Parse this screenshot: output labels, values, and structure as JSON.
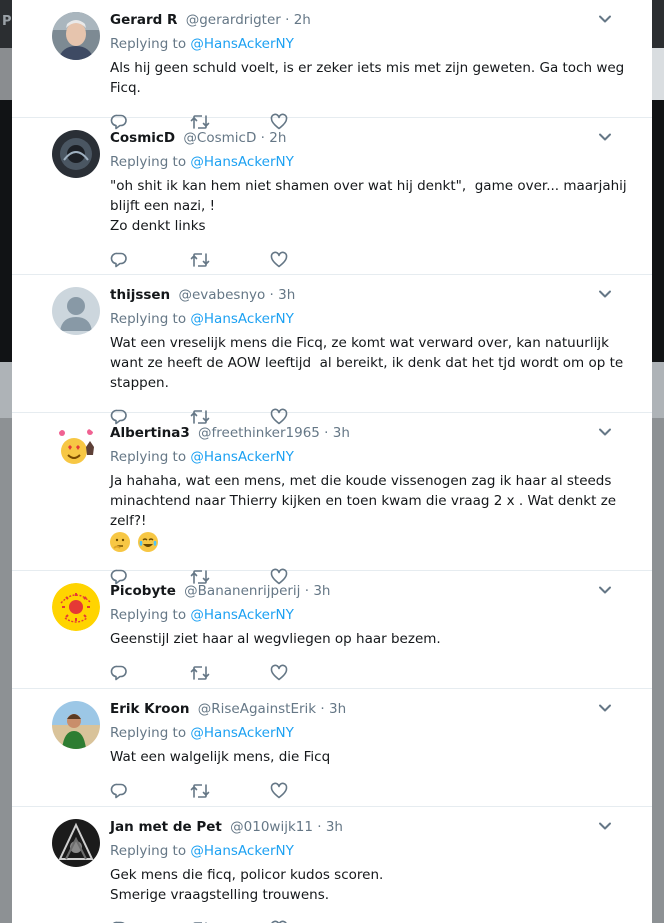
{
  "backdrop": {
    "corner_text": "P"
  },
  "replies": [
    {
      "name": "Gerard R",
      "handle": "@gerardrigter",
      "time": "· 2h",
      "replying_prefix": "Replying to ",
      "replying_to": "@HansAckerNY",
      "text": "Als hij geen schuld voelt, is er zeker iets mis met zijn geweten. Ga toch weg Ficq.",
      "avatar": "photo-older-man"
    },
    {
      "name": "CosmicD",
      "handle": "@CosmicD",
      "time": "· 2h",
      "replying_prefix": "Replying to ",
      "replying_to": "@HansAckerNY",
      "text": "\"oh shit ik kan hem niet shamen over wat hij denkt\",  game over... maarjahij blijft een nazi, !\nZo denkt links",
      "avatar": "dark-cosmic"
    },
    {
      "name": "thijssen",
      "handle": "@evabesnyo",
      "time": "· 3h",
      "replying_prefix": "Replying to ",
      "replying_to": "@HansAckerNY",
      "text": "Wat een vreselijk mens die Ficq, ze komt wat verward over, kan natuurlijk want ze heeft de AOW leeftijd  al bereikt, ik denk dat het tjd wordt om op te stappen.",
      "avatar": "default-egg"
    },
    {
      "name": "Albertina3",
      "handle": "@freethinker1965",
      "time": "· 3h",
      "replying_prefix": "Replying to ",
      "replying_to": "@HansAckerNY",
      "text": "Ja hahaha, wat een mens, met die koude vissenogen zag ik haar al steeds minachtend naar Thierry kijken en toen kwam die vraag 2 x . Wat denkt ze zelf?!",
      "emojis": [
        "thinking-face",
        "tears-of-joy-face"
      ],
      "avatar": "emoji-heart-eyes"
    },
    {
      "name": "Picobyte",
      "handle": "@Bananenrijperij",
      "time": "· 3h",
      "replying_prefix": "Replying to ",
      "replying_to": "@HansAckerNY",
      "text": "Geenstijl ziet haar al wegvliegen op haar bezem.",
      "avatar": "kernenergie-sticker",
      "avatar_text": {
        "top": "KERNENERGIE?",
        "bottom": "JA GRAAG"
      }
    },
    {
      "name": "Erik Kroon",
      "handle": "@RiseAgainstErik",
      "time": "· 3h",
      "replying_prefix": "Replying to ",
      "replying_to": "@HansAckerNY",
      "text": "Wat een walgelijk mens, die Ficq",
      "avatar": "photo-beach"
    },
    {
      "name": "Jan met de Pet",
      "handle": "@010wijk11",
      "time": "· 3h",
      "replying_prefix": "Replying to ",
      "replying_to": "@HansAckerNY",
      "text": "Gek mens die ficq, policor kudos scoren.\nSmerige vraagstelling trouwens.",
      "avatar": "dark-emblem"
    }
  ],
  "colors": {
    "link": "#1da1f2",
    "muted": "#657786",
    "text": "#14171a",
    "divider": "#e6ecf0"
  },
  "icons": {
    "reply": "reply-icon",
    "retweet": "retweet-icon",
    "like": "heart-icon",
    "more": "chevron-down-icon"
  }
}
